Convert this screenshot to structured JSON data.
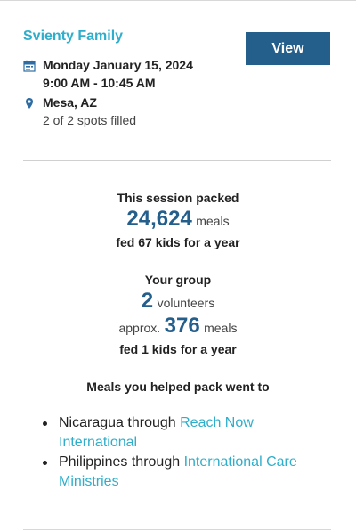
{
  "event": {
    "title": "Svienty Family",
    "view_label": "View",
    "date": "Monday January 15, 2024",
    "time": "9:00 AM - 10:45 AM",
    "location": "Mesa, AZ",
    "spots": "2 of 2 spots filled"
  },
  "session": {
    "heading": "This session packed",
    "meals_count": "24,624",
    "meals_unit": "meals",
    "fed_text": "fed 67 kids for a year"
  },
  "group": {
    "heading": "Your group",
    "volunteers_count": "2",
    "volunteers_unit": "volunteers",
    "approx_label": "approx.",
    "meals_count": "376",
    "meals_unit": "meals",
    "fed_text": "fed 1 kids for a year"
  },
  "destinations": {
    "heading": "Meals you helped pack went to",
    "items": [
      {
        "country": "Nicaragua",
        "through": "through",
        "partner": "Reach Now International"
      },
      {
        "country": "Philippines",
        "through": "through",
        "partner": "International Care Ministries"
      }
    ]
  },
  "icons": {
    "calendar": "calendar-icon",
    "location": "map-pin-icon"
  },
  "colors": {
    "accent": "#2eaecb",
    "button": "#245f8c",
    "number": "#245f8c"
  }
}
